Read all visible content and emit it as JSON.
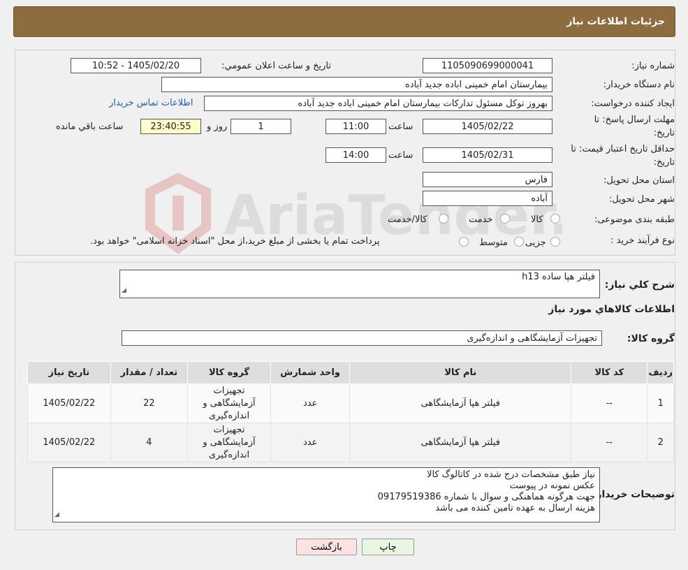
{
  "header": {
    "title": "جزئیات اطلاعات نیاز"
  },
  "form": {
    "need_number_label": "شماره نیاز:",
    "need_number": "1105090699000041",
    "announce_label": "تاریخ و ساعت اعلان عمومي:",
    "announce_value": "1405/02/20 - 10:52",
    "buyer_org_label": "نام دستگاه خريدار:",
    "buyer_org": "بیمارستان امام خمینی اباده جدید آباده",
    "requester_label": "ايجاد کننده درخواست:",
    "requester": "بهروز توکل مسئول تدارکات بیمارستان امام خمینی اباده جدید آباده",
    "contact_link": "اطلاعات تماس خریدار",
    "deadline_label_1": "مهلت ارسال پاسخ: تا",
    "deadline_label_2": "تاریخ:",
    "deadline_date": "1405/02/22",
    "time_label": "ساعت",
    "deadline_time": "11:00",
    "days_value": "1",
    "days_label": "روز و",
    "remaining_time": "23:40:55",
    "remaining_label": "ساعت باقي مانده",
    "validity_label_1": "حداقل تاریخ اعتبار قیمت: تا",
    "validity_label_2": "تاریخ:",
    "validity_date": "1405/02/31",
    "validity_time": "14:00",
    "province_label": "استان محل تحویل:",
    "province": "فارس",
    "city_label": "شهر محل تحویل:",
    "city": "آباده",
    "category_label": "طبقه بندی موضوعی:",
    "category_options": [
      "کالا",
      "خدمت",
      "کالا/خدمت"
    ],
    "process_label": "نوع فرآیند خرید :",
    "process_options": [
      "جزیی",
      "متوسط"
    ],
    "process_note": "پرداخت تمام یا بخشی از مبلغ خرید،از محل \"اسناد خزانه اسلامی\" خواهد بود."
  },
  "details": {
    "description_label": "شرح کلي نياز:",
    "description": "فیلتر هپا ساده h13",
    "items_title": "اطلاعات کالاهاي مورد نياز",
    "group_label": "گروه کالا:",
    "group": "تجهیزات آزمایشگاهی و اندازه‌گیری",
    "table_headers": [
      "رديف",
      "کد کالا",
      "نام کالا",
      "واحد شمارش",
      "گروه کالا",
      "تعداد / مقدار",
      "تاريخ نياز"
    ],
    "rows": [
      {
        "idx": "1",
        "code": "--",
        "name": "فیلتر هپا آزمایشگاهی",
        "unit": "عدد",
        "group": "تجهیزات آزمایشگاهی و اندازه‌گیری",
        "qty": "22",
        "date": "1405/02/22"
      },
      {
        "idx": "2",
        "code": "--",
        "name": "فیلتر هپا آزمایشگاهی",
        "unit": "عدد",
        "group": "تجهیزات آزمایشگاهی و اندازه‌گیری",
        "qty": "4",
        "date": "1405/02/22"
      }
    ],
    "buyer_notes_label": "توضیحات خریدار:",
    "buyer_notes": [
      "نیاز طبق مشخصات درج شده در کاتالوگ کالا",
      "عکس نمونه در پیوست",
      "جهت هرگونه هماهنگی و سوال با شماره 09179519386",
      "هزینه ارسال به عهده تامین کننده می باشد"
    ]
  },
  "buttons": {
    "print": "چاپ",
    "back": "بازگشت"
  },
  "watermark": {
    "text": "AriaTender.neT"
  },
  "colors": {
    "header_bg": "#8d6c3f",
    "link": "#1b5fb0",
    "back_button_bg": "#fbe3e3",
    "print_button_bg": "#eaf6e1",
    "remaining_bg": "#ffffcc"
  }
}
